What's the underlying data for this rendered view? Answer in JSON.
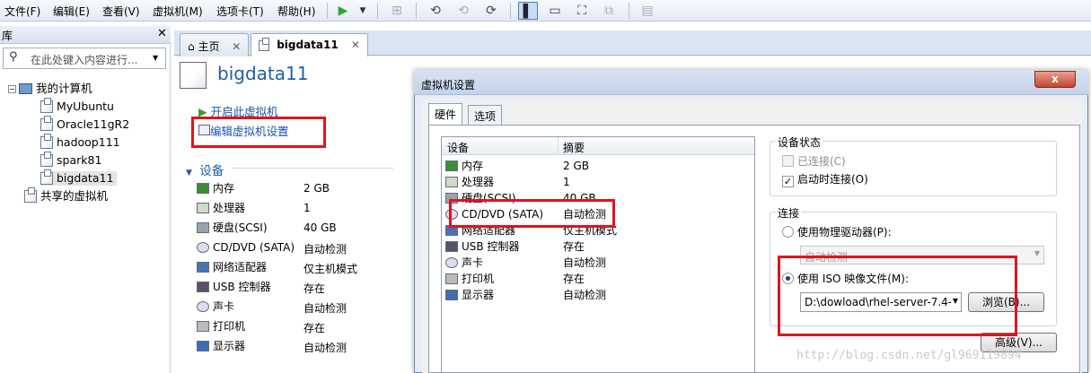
{
  "menubar": {
    "items": [
      "文件(F)",
      "编辑(E)",
      "查看(V)",
      "虚拟机(M)",
      "选项卡(T)",
      "帮助(H)"
    ]
  },
  "library": {
    "title": "库",
    "search_placeholder": "在此处键入内容进行...",
    "root": "我的计算机",
    "vms": [
      "MyUbuntu",
      "Oracle11gR2",
      "hadoop111",
      "spark81",
      "bigdata11"
    ],
    "shared": "共享的虚拟机"
  },
  "tabs": [
    {
      "label": "主页"
    },
    {
      "label": "bigdata11"
    }
  ],
  "vm": {
    "title": "bigdata11",
    "start_link": "开启此虚拟机",
    "edit_link": "编辑虚拟机设置",
    "devices_section": "设备",
    "devices": [
      {
        "name": "内存",
        "value": "2 GB",
        "icon": "memory-icon"
      },
      {
        "name": "处理器",
        "value": "1",
        "icon": "cpu-icon"
      },
      {
        "name": "硬盘(SCSI)",
        "value": "40 GB",
        "icon": "harddisk-icon"
      },
      {
        "name": "CD/DVD (SATA)",
        "value": "自动检测",
        "icon": "cd-icon"
      },
      {
        "name": "网络适配器",
        "value": "仅主机模式",
        "icon": "network-icon"
      },
      {
        "name": "USB 控制器",
        "value": "存在",
        "icon": "usb-icon"
      },
      {
        "name": "声卡",
        "value": "自动检测",
        "icon": "sound-icon"
      },
      {
        "name": "打印机",
        "value": "存在",
        "icon": "printer-icon"
      },
      {
        "name": "显示器",
        "value": "自动检测",
        "icon": "display-icon"
      }
    ]
  },
  "dialog": {
    "title": "虚拟机设置",
    "close": "x",
    "tabs": [
      "硬件",
      "选项"
    ],
    "list_headers": [
      "设备",
      "摘要"
    ],
    "list": [
      {
        "name": "内存",
        "value": "2 GB"
      },
      {
        "name": "处理器",
        "value": "1"
      },
      {
        "name": "硬盘(SCSI)",
        "value": "40 GB"
      },
      {
        "name": "CD/DVD (SATA)",
        "value": "自动检测"
      },
      {
        "name": "网络适配器",
        "value": "仅主机模式"
      },
      {
        "name": "USB 控制器",
        "value": "存在"
      },
      {
        "name": "声卡",
        "value": "自动检测"
      },
      {
        "name": "打印机",
        "value": "存在"
      },
      {
        "name": "显示器",
        "value": "自动检测"
      }
    ],
    "device_status": {
      "label": "设备状态",
      "connected": "已连接(C)",
      "connect_on_start": "启动时连接(O)"
    },
    "connection": {
      "label": "连接",
      "physical": "使用物理驱动器(P):",
      "physical_value": "自动检测",
      "iso": "使用 ISO 映像文件(M):",
      "iso_path": "D:\\dowload\\rhel-server-7.4-",
      "browse": "浏览(B)..."
    },
    "advanced": "高级(V)..."
  },
  "watermark": "http://blog.csdn.net/gl969119894"
}
